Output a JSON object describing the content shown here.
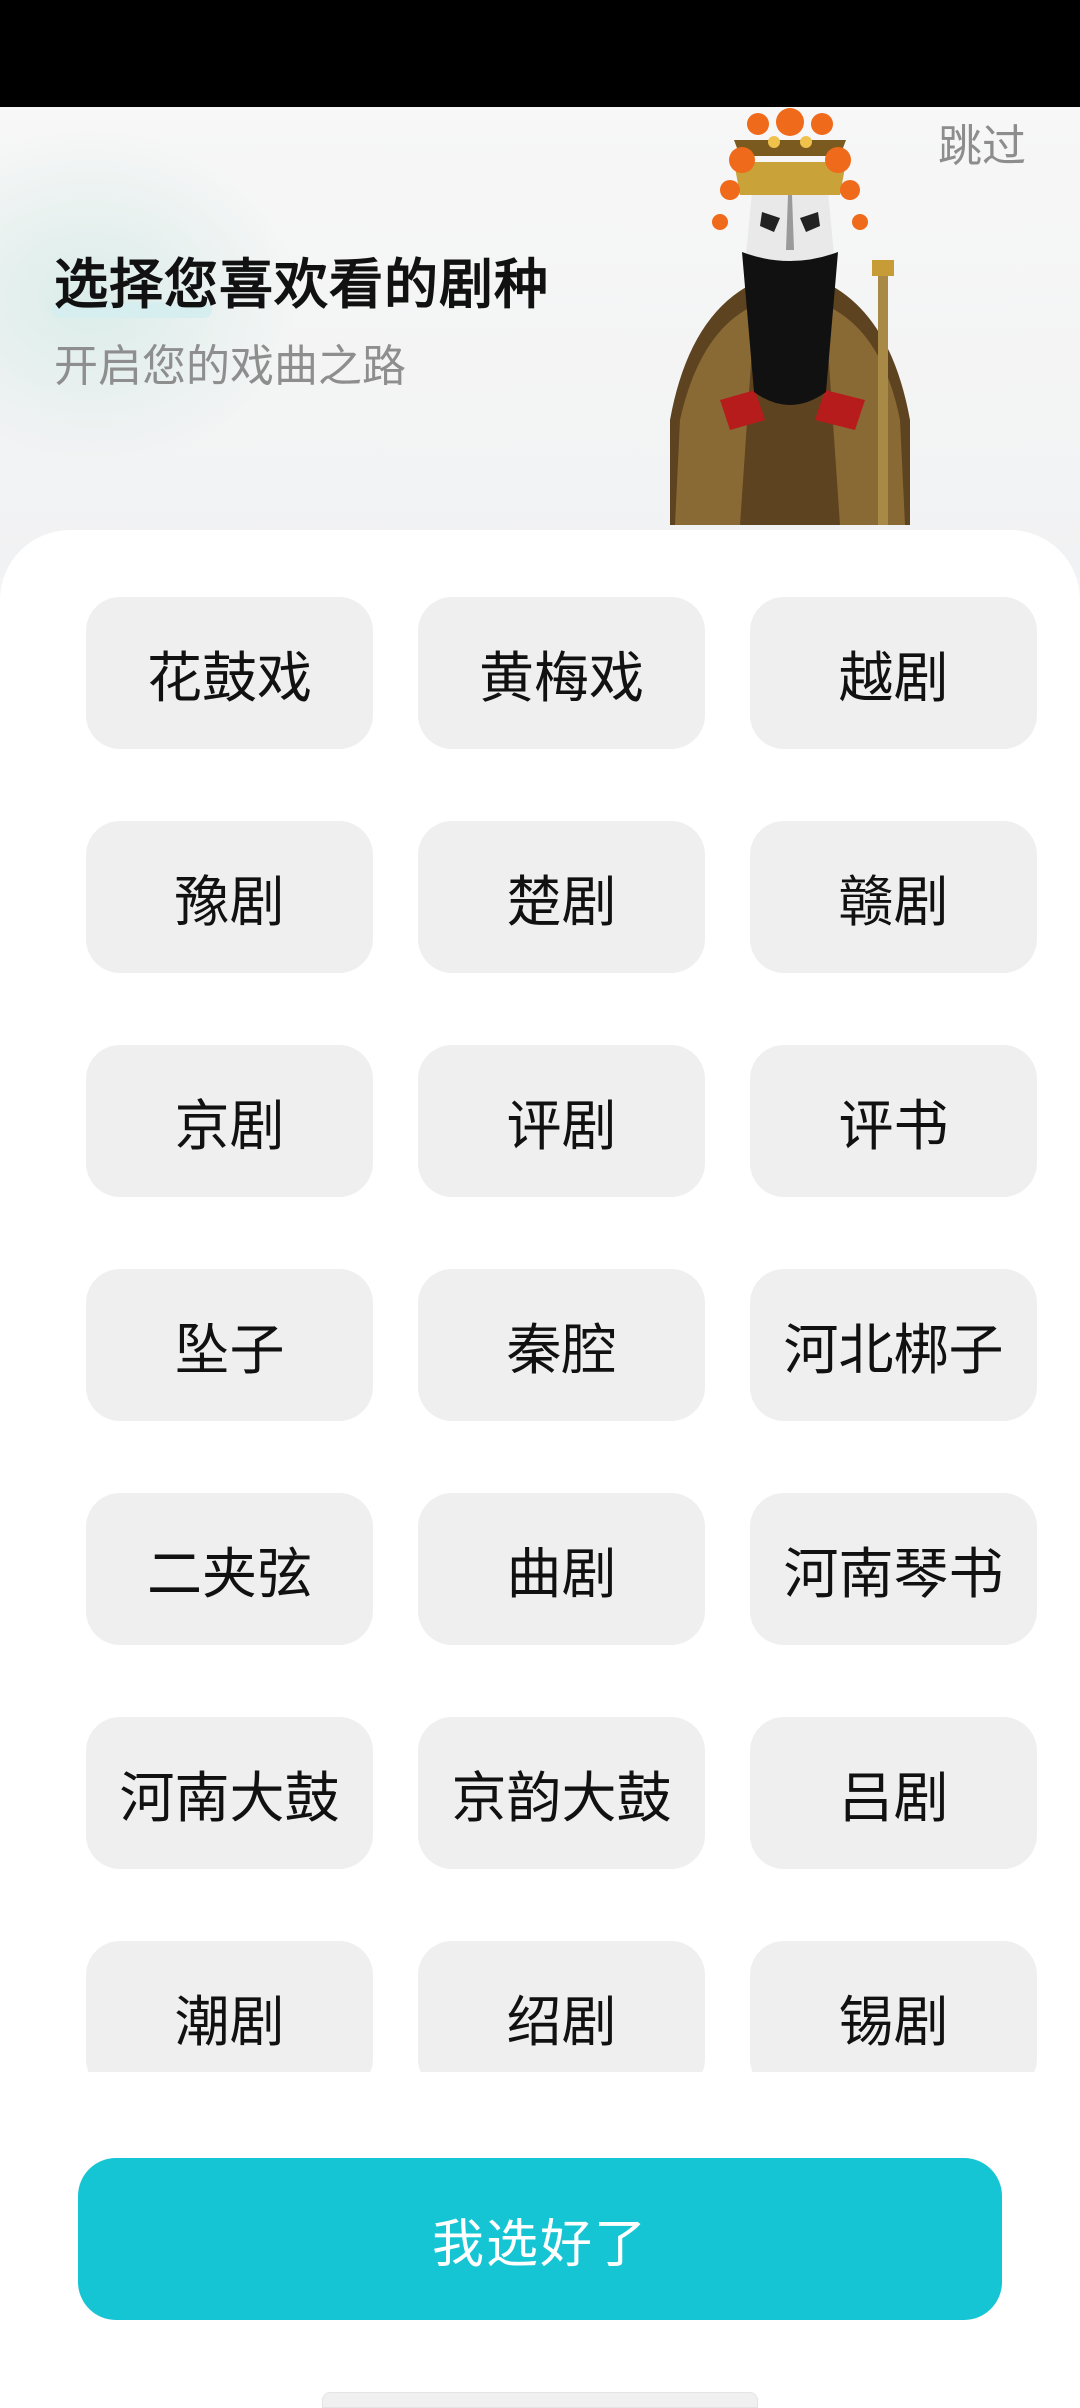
{
  "header": {
    "skip_label": "跳过",
    "title": "选择您喜欢看的剧种",
    "subtitle": "开启您的戏曲之路",
    "illustration": "peking-opera-figure"
  },
  "genres": [
    "花鼓戏",
    "黄梅戏",
    "越剧",
    "豫剧",
    "楚剧",
    "赣剧",
    "京剧",
    "评剧",
    "评书",
    "坠子",
    "秦腔",
    "河北梆子",
    "二夹弦",
    "曲剧",
    "河南琴书",
    "河南大鼓",
    "京韵大鼓",
    "吕剧",
    "潮剧",
    "绍剧",
    "锡剧"
  ],
  "confirm_label": "我选好了",
  "colors": {
    "accent": "#16c5d3",
    "chip_bg": "#efefef",
    "header_bg": "#f3f4f5"
  }
}
